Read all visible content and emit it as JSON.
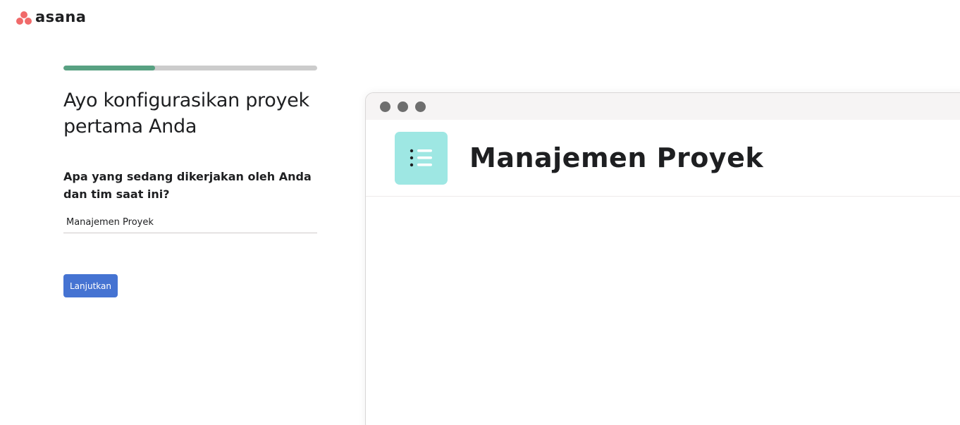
{
  "brand": {
    "name": "asana",
    "color": "#f06a6a",
    "icon": "asana-logo-icon"
  },
  "progress": {
    "value": 0.36,
    "fill_color": "#58a182",
    "track_color": "#cccccc"
  },
  "setup": {
    "heading": "Ayo konfigurasikan proyek pertama Anda",
    "question": "Apa yang sedang dikerjakan oleh Anda dan tim saat ini?",
    "project_name_value": "Manajemen Proyek",
    "continue_label": "Lanjutkan",
    "button_color": "#4573d2"
  },
  "preview": {
    "window_dots": [
      "dot",
      "dot",
      "dot"
    ],
    "project_icon": "list-icon",
    "project_icon_color": "#9ee7e3",
    "project_title": "Manajemen Proyek"
  }
}
